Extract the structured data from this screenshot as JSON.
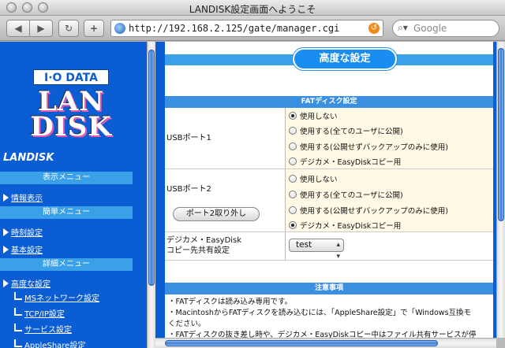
{
  "window": {
    "title": "LANDISK設定画面へようこそ"
  },
  "toolbar": {
    "url": "http://192.168.2.125/gate/manager.cgi",
    "search_placeholder": "Google",
    "back_label": "◀",
    "forward_label": "▶",
    "reload_label": "↻",
    "add_label": "+"
  },
  "sidebar": {
    "brand_io": "I·O DATA",
    "brand_logo_line1": "LAN",
    "brand_logo_line2": "DISK",
    "product": "LANDISK",
    "sections": [
      {
        "header": "表示メニュー",
        "items": [
          "情報表示"
        ]
      },
      {
        "header": "簡単メニュー",
        "items": [
          "時刻設定",
          "基本設定"
        ]
      },
      {
        "header": "詳細メニュー",
        "items": [
          "高度な設定"
        ],
        "subitems": [
          "MSネットワーク設定",
          "TCP/IP設定",
          "サービス設定",
          "AppleShare設定"
        ]
      }
    ]
  },
  "main": {
    "title": "高度な設定",
    "fat_section": "FATディスク設定",
    "usb1": {
      "label": "USBポート1",
      "options": [
        "使用しない",
        "使用する(全てのユーザに公開)",
        "使用する(公開せずバックアップのみに使用)",
        "デジカメ・EasyDiskコピー用"
      ],
      "selected": 0
    },
    "usb2": {
      "label": "USBポート2",
      "button": "ポート2取り外し",
      "options": [
        "使用しない",
        "使用する(全てのユーザに公開)",
        "使用する(公開せずバックアップのみに使用)",
        "デジカメ・EasyDiskコピー用"
      ],
      "selected": 3
    },
    "share": {
      "label_line1": "デジカメ・EasyDisk",
      "label_line2": "コピー先共有設定",
      "value": "test"
    },
    "notes_section": "注意事項",
    "notes": [
      "・FATディスクは読み込み専用です。",
      "・MacintoshからFATディスクを読み込むには、「AppleShare設定」で「Windows互換モ",
      "ください。",
      "・FATディスクの抜き差し時や、デジカメ・EasyDiskコピー中はファイル共有サービスが停"
    ]
  }
}
